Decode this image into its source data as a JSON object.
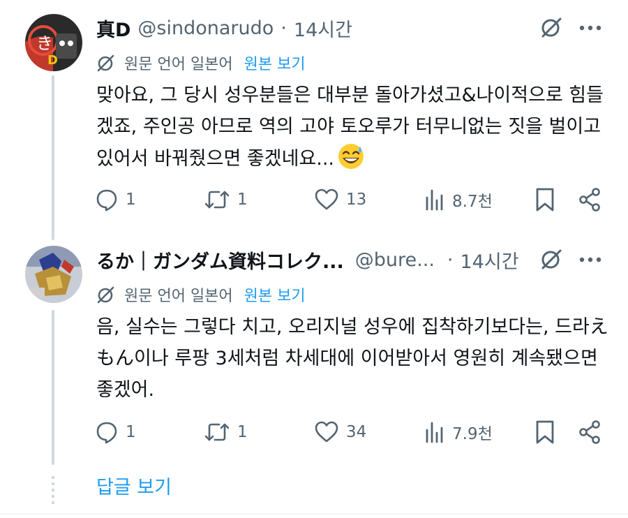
{
  "tweets": [
    {
      "display_name": "真D",
      "handle": "@sindonarudo",
      "separator": "·",
      "time": "14시간",
      "translation_label": "원문 언어 일본어",
      "show_original": "원본 보기",
      "text": "맞아요, 그 당시 성우분들은 대부분 돌아가셨고&나이적으로 힘들겠죠, 주인공 아므로 역의 고야 토오루가 터무니없는 짓을 벌이고 있어서 바꿔줬으면 좋겠네요...",
      "emoji": "grinning-sweat-emoji",
      "replies": "1",
      "reposts": "1",
      "likes": "13",
      "views": "8.7천"
    },
    {
      "display_name": "るか｜ガンダム資料コレク...",
      "handle": "@bure...",
      "separator": "·",
      "time": "14시간",
      "translation_label": "원문 언어 일본어",
      "show_original": "원본 보기",
      "text": "음, 실수는 그렇다 치고, 오리지널 성우에 집착하기보다는, 드라えもん이나 루팡 3세처럼 차세대에 이어받아서 영원히 계속됐으면 좋겠어.",
      "replies": "1",
      "reposts": "1",
      "likes": "34",
      "views": "7.9천"
    }
  ],
  "show_replies": "답글 보기",
  "colors": {
    "accent": "#1d9bf0",
    "muted": "#536471",
    "text": "#0f1419",
    "thread_line": "#cfd9de"
  }
}
